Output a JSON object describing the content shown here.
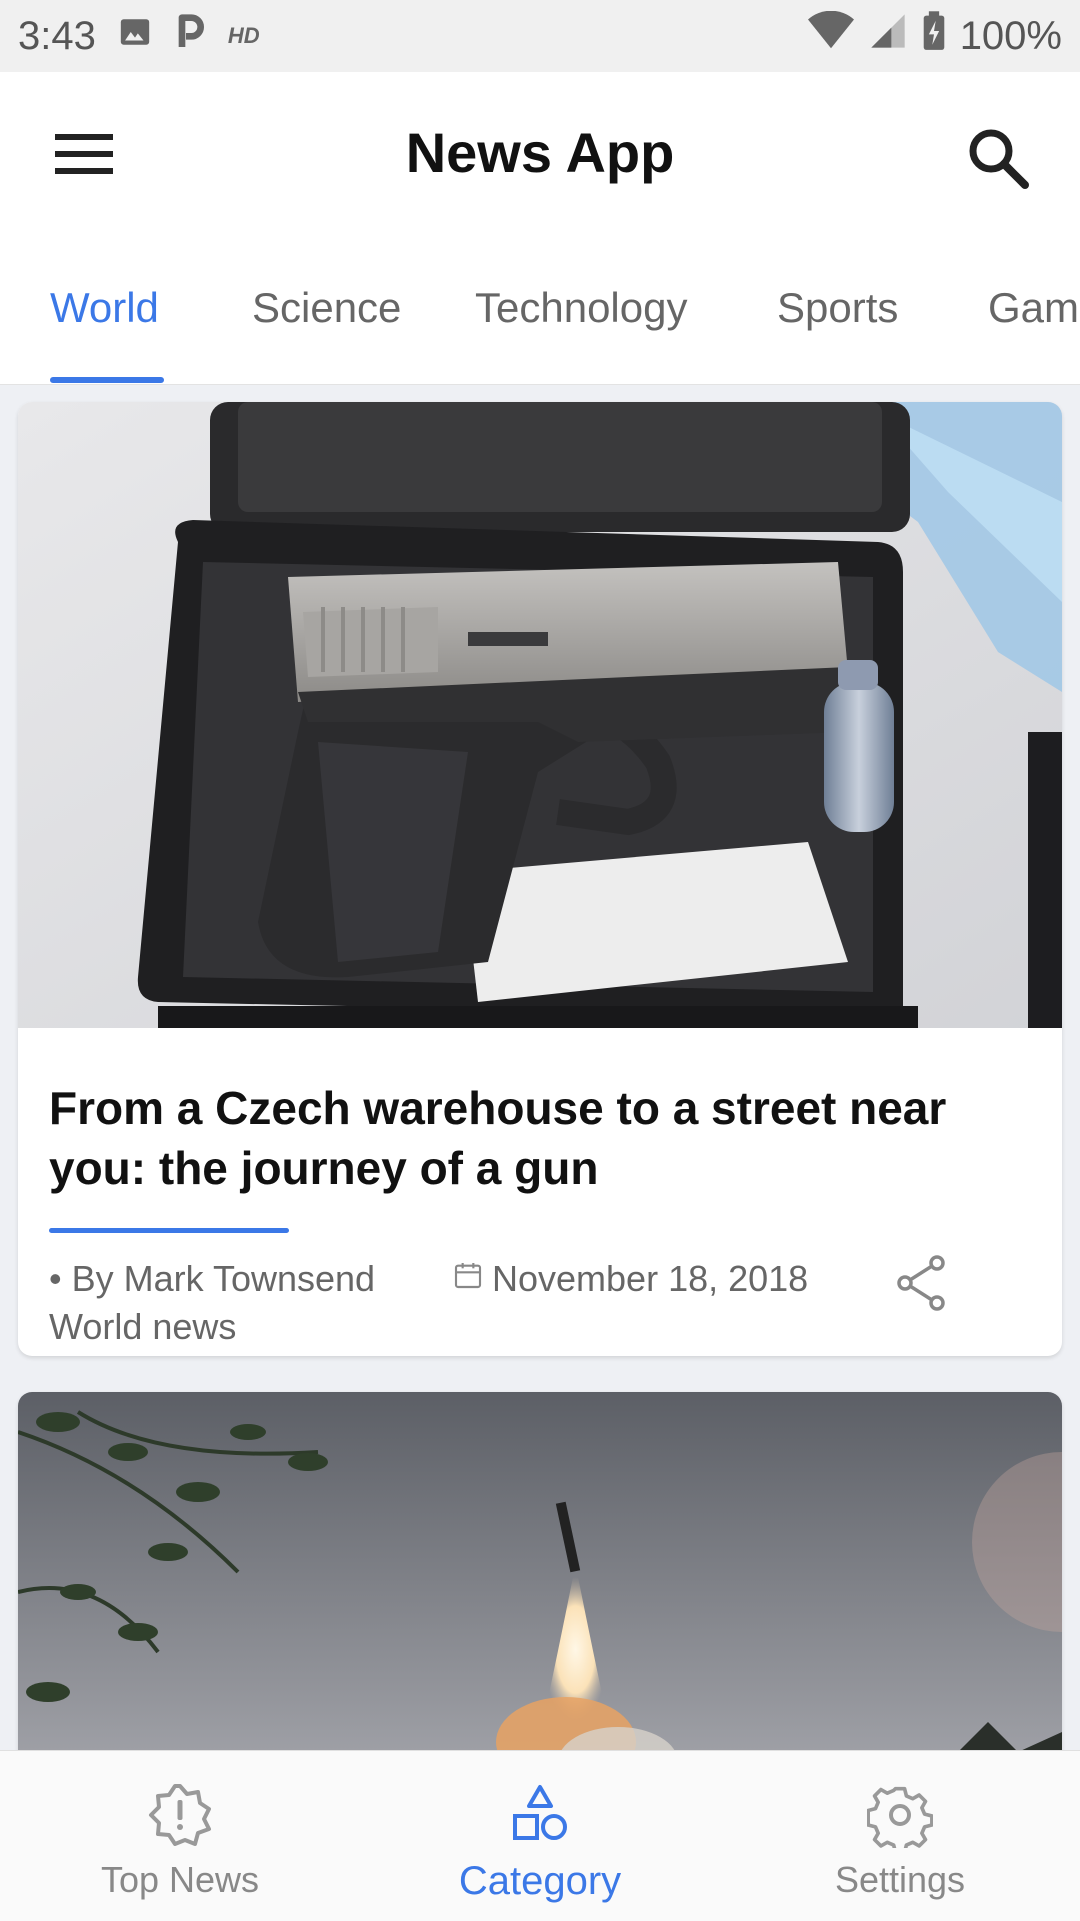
{
  "status_bar": {
    "time": "3:43",
    "hd": "HD",
    "battery": "100%"
  },
  "app_bar": {
    "title": "News App",
    "menu_icon": "menu-icon",
    "search_icon": "search-icon"
  },
  "tabs": [
    {
      "label": "World",
      "active": true
    },
    {
      "label": "Science",
      "active": false
    },
    {
      "label": "Technology",
      "active": false
    },
    {
      "label": "Sports",
      "active": false
    },
    {
      "label": "Gam",
      "active": false
    }
  ],
  "articles": [
    {
      "title": "From a Czech warehouse to a street near you: the journey of a gun",
      "author": "• By Mark Townsend",
      "date": "November 18, 2018",
      "section": "World news",
      "image": "handgun in open case"
    },
    {
      "image": "missile launch over trees"
    }
  ],
  "bottom_nav": [
    {
      "label": "Top News",
      "icon": "alert-badge-icon",
      "active": false
    },
    {
      "label": "Category",
      "icon": "shapes-icon",
      "active": true
    },
    {
      "label": "Settings",
      "icon": "gear-icon",
      "active": false
    }
  ],
  "colors": {
    "accent": "#3b78e7",
    "inactive": "#888888",
    "background": "#eef0f4"
  }
}
